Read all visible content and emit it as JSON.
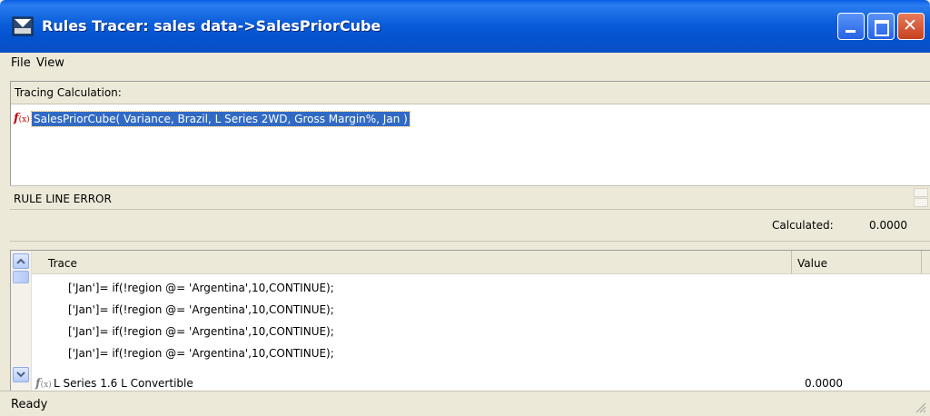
{
  "window": {
    "title": "Rules Tracer: sales data->SalesPriorCube"
  },
  "menu": {
    "file": "File",
    "view": "View"
  },
  "tracing": {
    "header": "Tracing Calculation:",
    "root_label": "SalesPriorCube( Variance, Brazil, L Series 2WD, Gross Margin%, Jan )",
    "icon": "fx-function-icon"
  },
  "error_line": "RULE LINE ERROR",
  "calculated": {
    "label": "Calculated:",
    "value": "0.0000"
  },
  "trace_list": {
    "columns": [
      "Trace",
      "Value"
    ],
    "rows": [
      "['Jan']= if(!region @= 'Argentina',10,CONTINUE);",
      "['Jan']= if(!region @= 'Argentina',10,CONTINUE);",
      "['Jan']= if(!region @= 'Argentina',10,CONTINUE);",
      "['Jan']= if(!region @= 'Argentina',10,CONTINUE);"
    ],
    "last_item": {
      "label": "L Series 1.6 L Convertible",
      "value": "0.0000"
    }
  },
  "status": "Ready"
}
